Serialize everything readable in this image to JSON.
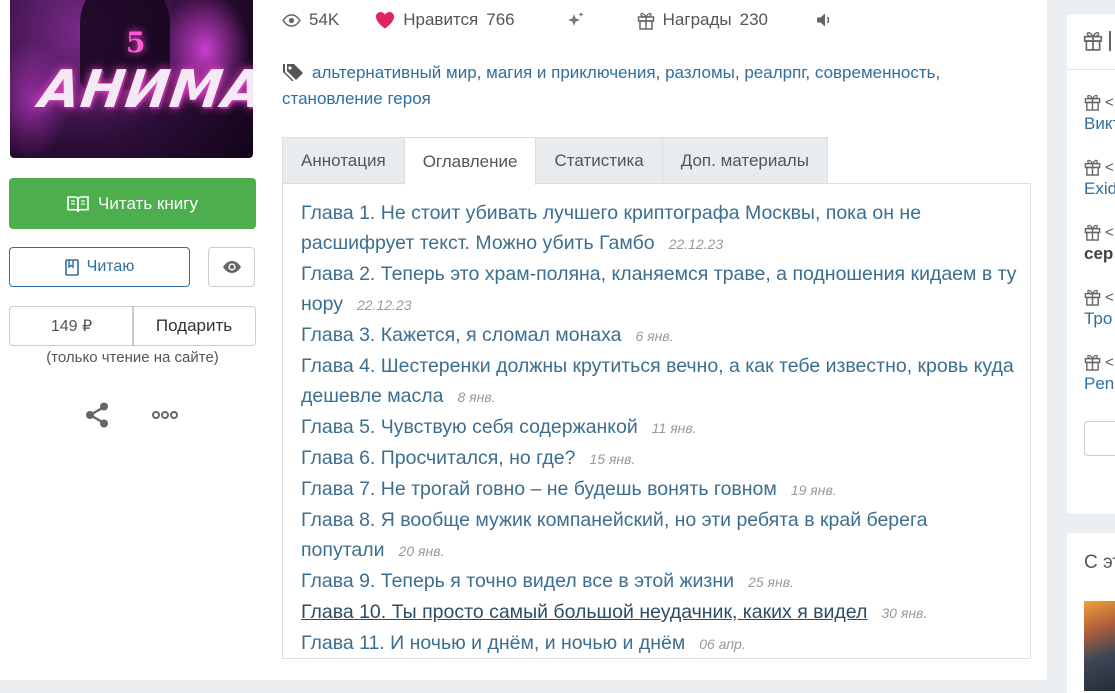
{
  "book": {
    "cover_number": "5",
    "cover_title": "АНИМА",
    "read_button": "Читать книгу",
    "reading_button": "Читаю",
    "price": "149 ₽",
    "gift_button": "Подарить",
    "price_note": "(только чтение на сайте)"
  },
  "stats": {
    "views": "54K",
    "likes_label": "Нравится",
    "likes_count": "766",
    "awards_label": "Награды",
    "awards_count": "230"
  },
  "tags": [
    "альтернативный мир",
    "магия и приключения",
    "разломы",
    "реалрпг",
    "современность",
    "становление героя"
  ],
  "tag_separator": ",",
  "tabs": [
    {
      "label": "Аннотация",
      "active": false
    },
    {
      "label": "Оглавление",
      "active": true
    },
    {
      "label": "Статистика",
      "active": false
    },
    {
      "label": "Доп. материалы",
      "active": false
    }
  ],
  "chapters": [
    {
      "title": "Глава 1. Не стоит убивать лучшего криптографа Москвы, пока он не расшифрует текст. Можно убить Гамбо",
      "date": "22.12.23"
    },
    {
      "title": "Глава 2. Теперь это храм-поляна, кланяемся траве, а подношения кидаем в ту нору",
      "date": "22.12.23"
    },
    {
      "title": "Глава 3. Кажется, я сломал монаха",
      "date": "6 янв."
    },
    {
      "title": "Глава 4. Шестеренки должны крутиться вечно, а как тебе известно, кровь куда дешевле масла",
      "date": "8 янв."
    },
    {
      "title": "Глава 5. Чувствую себя содержанкой",
      "date": "11 янв."
    },
    {
      "title": "Глава 6. Просчитался, но где?",
      "date": "15 янв."
    },
    {
      "title": "Глава 7. Не трогай говно – не будешь вонять говном",
      "date": "19 янв."
    },
    {
      "title": "Глава 8. Я вообще мужик компанейский, но эти ребята в край берега попутали",
      "date": "20 янв."
    },
    {
      "title": "Глава 9. Теперь я точно видел все в этой жизни",
      "date": "25 янв."
    },
    {
      "title": "Глава 10. Ты просто самый большой неудачник, каких я видел",
      "date": "30 янв.",
      "hovered": true
    },
    {
      "title": "Глава 11. И ночью и днём, и ночью и днём",
      "date": "06 апр."
    }
  ],
  "sidebar": {
    "gifts_header": "",
    "gift_prefix": "<",
    "gifters": [
      "Викт",
      "Exid",
      "сер",
      "Тро",
      "Penz"
    ],
    "similar_header": "С эт"
  },
  "colors": {
    "link": "#2f6f9f",
    "chapter_link": "#3c6e8f",
    "read_button": "#4cae4c",
    "like_heart": "#e0245e",
    "page_bg": "#eceff1"
  }
}
